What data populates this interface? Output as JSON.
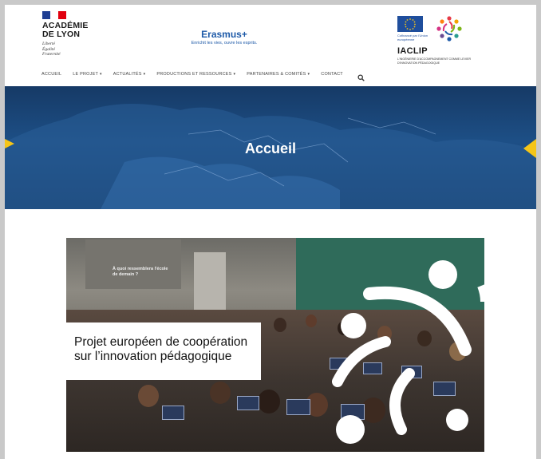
{
  "header": {
    "academy": {
      "name_line1": "ACADÉMIE",
      "name_line2": "DE LYON",
      "motto": [
        "Liberté",
        "Égalité",
        "Fraternité"
      ]
    },
    "erasmus": {
      "title": "Erasmus+",
      "tagline": "Enrichit les vies, ouvre les esprits."
    },
    "partners": {
      "eu_caption": "Cofinancé par l'Union européenne",
      "iaclip_name": "IACLIP",
      "iaclip_sub": "L'INGÉNIERIE D'ACCOMPAGNEMENT COMME LEVIER D'INNOVATION PÉDAGOGIQUE"
    }
  },
  "nav": {
    "items": [
      {
        "label": "ACCUEIL",
        "dropdown": false
      },
      {
        "label": "LE PROJET",
        "dropdown": true
      },
      {
        "label": "ACTUALITÉS",
        "dropdown": true
      },
      {
        "label": "PRODUCTIONS ET RESSOURCES",
        "dropdown": true
      },
      {
        "label": "PARTENAIRES & COMITÉS",
        "dropdown": true
      },
      {
        "label": "CONTACT",
        "dropdown": false
      }
    ],
    "caret": "▾",
    "search_icon": "search-icon"
  },
  "hero": {
    "title": "Accueil"
  },
  "feature": {
    "screen_text": "À quoi ressemblera l'école de demain ?",
    "caption": "Projet européen de coopération sur l’innovation pédagogique"
  },
  "colors": {
    "brand_blue": "#1e5aa8",
    "hero_blue": "#1d4f86",
    "eu_blue": "#1f4e9c",
    "eu_star": "#f5c518"
  }
}
